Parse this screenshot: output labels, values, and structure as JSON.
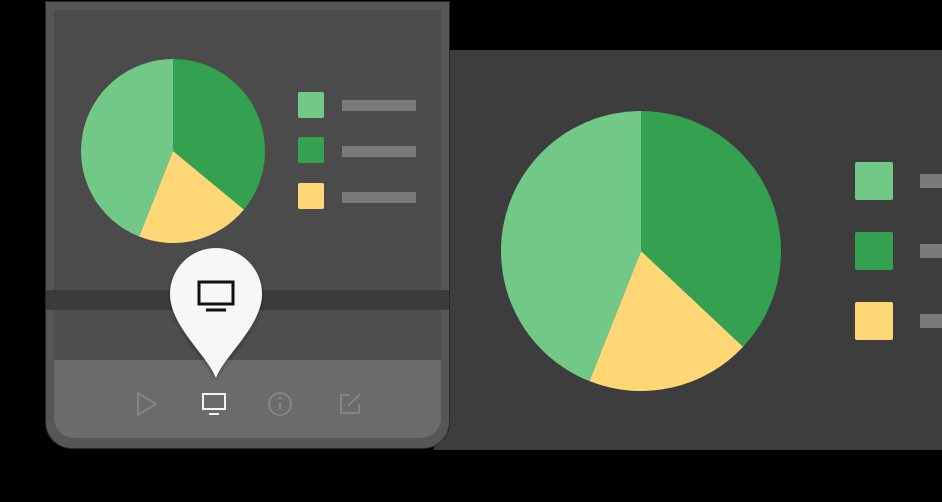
{
  "chart_data": [
    {
      "type": "pie",
      "slices": [
        {
          "value": 36,
          "color": "#34a150"
        },
        {
          "value": 20,
          "color": "#ffd777"
        },
        {
          "value": 44,
          "color": "#72c887"
        }
      ]
    },
    {
      "type": "pie",
      "slices": [
        {
          "value": 37,
          "color": "#34a150"
        },
        {
          "value": 19,
          "color": "#ffd777"
        },
        {
          "value": 44,
          "color": "#72c887"
        }
      ]
    }
  ],
  "legend_colors": [
    "#72c887",
    "#34a150",
    "#ffd777"
  ],
  "toolbar": {
    "icons": [
      "play-icon",
      "monitor-icon",
      "info-icon",
      "edit-icon"
    ],
    "active": "monitor-icon"
  },
  "tooltip": {
    "icon": "monitor-icon"
  }
}
